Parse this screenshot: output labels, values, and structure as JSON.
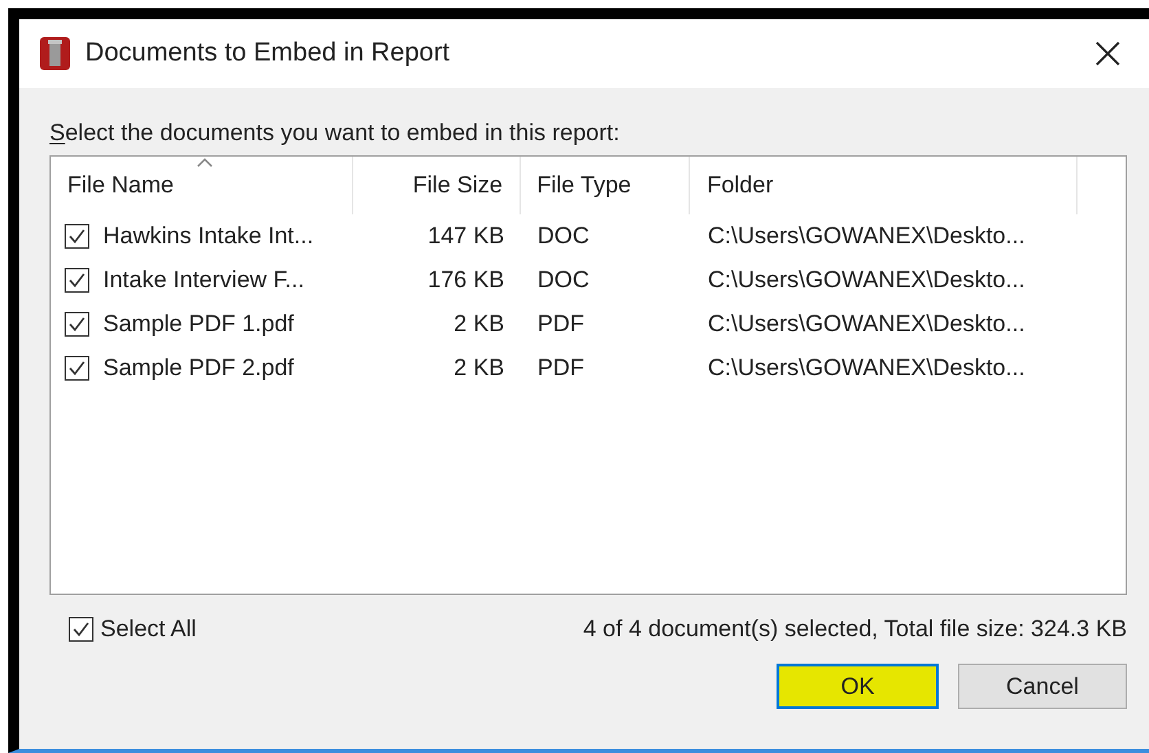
{
  "window": {
    "title": "Documents to Embed in Report"
  },
  "instruction": "Select the documents you want to embed in this report:",
  "table": {
    "columns": [
      {
        "label": "File Name",
        "sorted": true
      },
      {
        "label": "File Size",
        "sorted": false
      },
      {
        "label": "File Type",
        "sorted": false
      },
      {
        "label": "Folder",
        "sorted": false
      }
    ],
    "rows": [
      {
        "checked": true,
        "cells": [
          "Hawkins Intake Int...",
          "147 KB",
          "DOC",
          "C:\\Users\\GOWANEX\\Deskto..."
        ]
      },
      {
        "checked": true,
        "cells": [
          "Intake Interview F...",
          "176 KB",
          "DOC",
          "C:\\Users\\GOWANEX\\Deskto..."
        ]
      },
      {
        "checked": true,
        "cells": [
          "Sample PDF 1.pdf",
          "2 KB",
          "PDF",
          "C:\\Users\\GOWANEX\\Deskto..."
        ]
      },
      {
        "checked": true,
        "cells": [
          "Sample PDF 2.pdf",
          "2 KB",
          "PDF",
          "C:\\Users\\GOWANEX\\Deskto..."
        ]
      }
    ]
  },
  "select_all": {
    "label": "Select All",
    "checked": true
  },
  "summary": "4 of 4 document(s) selected, Total file size: 324.3 KB",
  "buttons": [
    {
      "label": "OK",
      "default": true
    },
    {
      "label": "Cancel",
      "default": false
    }
  ]
}
